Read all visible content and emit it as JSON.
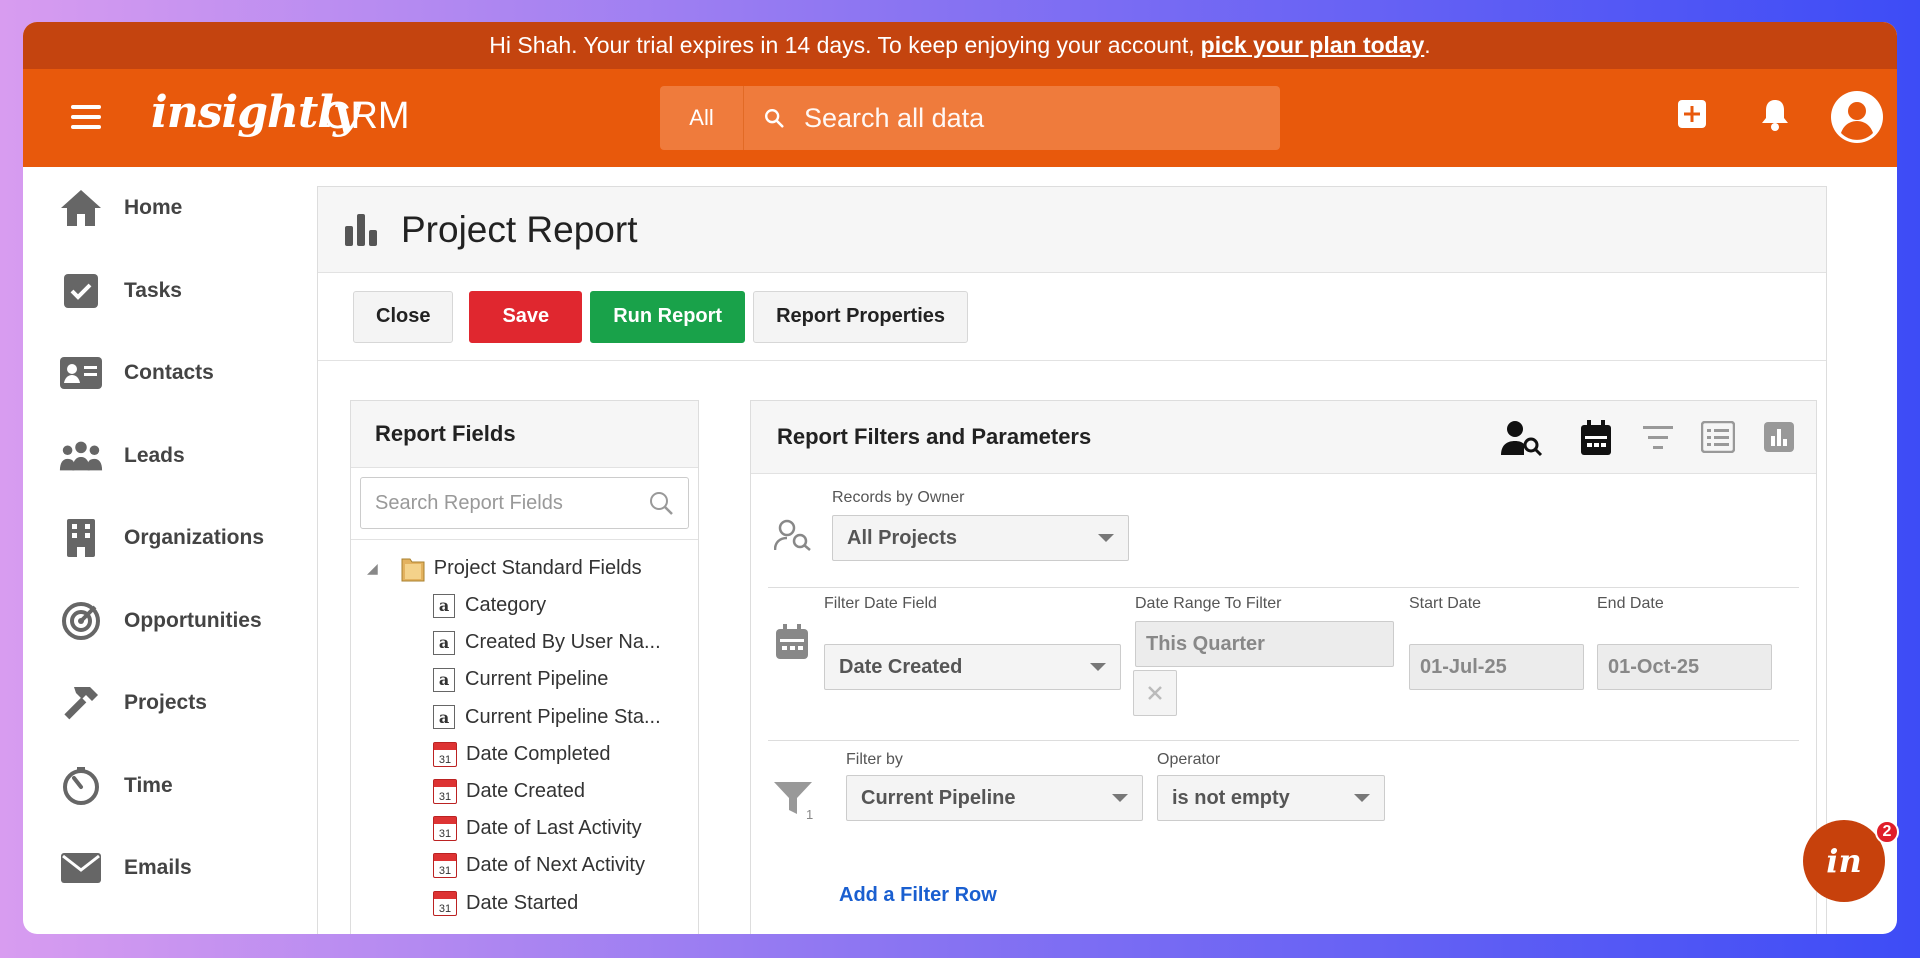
{
  "banner": {
    "text": "Hi Shah. Your trial expires in 14 days. To keep enjoying your account,",
    "link": "pick your plan today",
    "tail": "."
  },
  "header": {
    "logo": "insightly",
    "product": "CRM",
    "search_scope": "All",
    "search_placeholder": "Search all data"
  },
  "sidebar": {
    "items": [
      {
        "label": "Home",
        "icon": "home-icon"
      },
      {
        "label": "Tasks",
        "icon": "check-icon"
      },
      {
        "label": "Contacts",
        "icon": "contact-card-icon"
      },
      {
        "label": "Leads",
        "icon": "people-icon"
      },
      {
        "label": "Organizations",
        "icon": "building-icon"
      },
      {
        "label": "Opportunities",
        "icon": "target-icon"
      },
      {
        "label": "Projects",
        "icon": "hammer-icon"
      },
      {
        "label": "Time",
        "icon": "stopwatch-icon"
      },
      {
        "label": "Emails",
        "icon": "envelope-icon"
      }
    ]
  },
  "page": {
    "title": "Project Report"
  },
  "toolbar": {
    "close": "Close",
    "save": "Save",
    "run": "Run Report",
    "properties": "Report Properties"
  },
  "report_fields": {
    "title": "Report Fields",
    "search_placeholder": "Search Report Fields",
    "root": "Project Standard Fields",
    "items": [
      {
        "label": "Category",
        "type": "text"
      },
      {
        "label": "Created By User Na...",
        "type": "text"
      },
      {
        "label": "Current Pipeline",
        "type": "text"
      },
      {
        "label": "Current Pipeline Sta...",
        "type": "text"
      },
      {
        "label": "Date Completed",
        "type": "date"
      },
      {
        "label": "Date Created",
        "type": "date"
      },
      {
        "label": "Date of Last Activity",
        "type": "date"
      },
      {
        "label": "Date of Next Activity",
        "type": "date"
      },
      {
        "label": "Date Started",
        "type": "date"
      }
    ]
  },
  "filters": {
    "title": "Report Filters and Parameters",
    "owner_label": "Records by Owner",
    "owner_value": "All Projects",
    "date_field_label": "Filter Date Field",
    "date_field_value": "Date Created",
    "range_label": "Date Range To Filter",
    "range_value": "This Quarter",
    "start_label": "Start Date",
    "start_value": "01-Jul-25",
    "end_label": "End Date",
    "end_value": "01-Oct-25",
    "filter_by_label": "Filter by",
    "filter_by_value": "Current Pipeline",
    "operator_label": "Operator",
    "operator_value": "is not empty",
    "filter_index": "1",
    "add_row": "Add a Filter Row"
  },
  "chat": {
    "label": "in",
    "badge": "2"
  },
  "colors": {
    "brand": "#e8590c",
    "banner": "#c4440f",
    "save": "#e0272f",
    "run": "#19a24a",
    "link": "#1a5fd0"
  }
}
